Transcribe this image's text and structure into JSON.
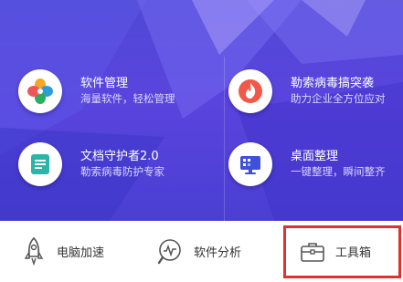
{
  "tiles": [
    {
      "title": "软件管理",
      "subtitle": "海量软件，轻松管理",
      "icon": "clover-icon"
    },
    {
      "title": "勒索病毒搞突袭",
      "subtitle": "助力企业全方位应对",
      "icon": "flame-icon"
    },
    {
      "title": "文档守护者2.0",
      "subtitle": "勒索病毒防护专家",
      "icon": "document-icon"
    },
    {
      "title": "桌面整理",
      "subtitle": "一键整理，瞬间整齐",
      "icon": "monitor-icon"
    }
  ],
  "toolbar": {
    "speedup_label": "电脑加速",
    "analysis_label": "软件分析",
    "toolbox_label": "工具箱"
  },
  "colors": {
    "hero_bg": "#5146d9",
    "highlight": "#e03131"
  }
}
